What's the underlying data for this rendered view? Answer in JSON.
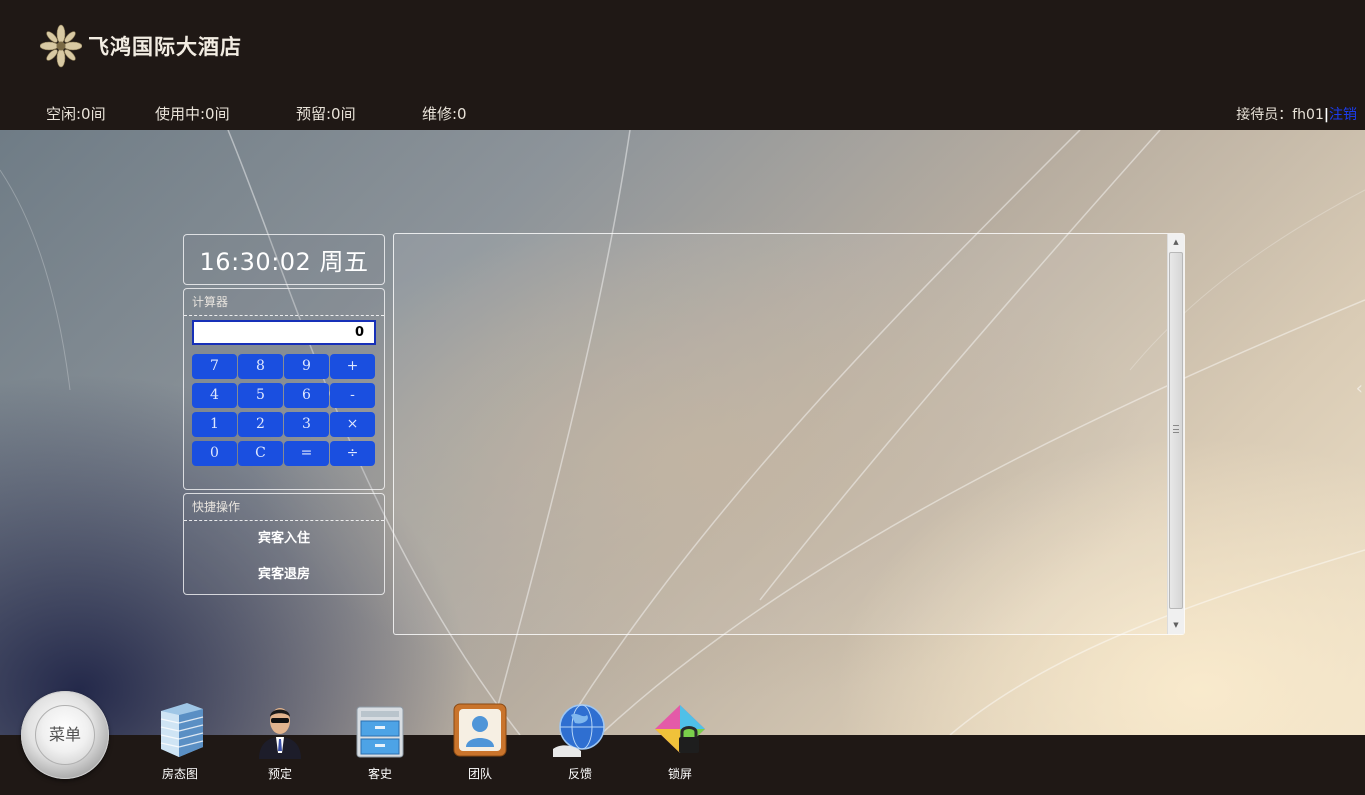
{
  "header": {
    "hotel_name": "飞鸿国际大酒店",
    "stats": {
      "vacant": "空闲:0间",
      "in_use": "使用中:0间",
      "reserved": "预留:0间",
      "maintenance": "维修:0"
    },
    "receptionist_label": "接待员：fh01",
    "separator": "|",
    "logout": "注销"
  },
  "clock": {
    "display": "16:30:02 周五"
  },
  "calculator": {
    "title": "计算器",
    "display_value": "0",
    "keys": [
      "7",
      "8",
      "9",
      "+",
      "4",
      "5",
      "6",
      "-",
      "1",
      "2",
      "3",
      "×",
      "0",
      "C",
      "=",
      "÷"
    ]
  },
  "quick_actions": {
    "title": "快捷操作",
    "items": [
      "宾客入住",
      "宾客退房"
    ]
  },
  "taskbar": {
    "menu_label": "菜单",
    "items": [
      {
        "label": "房态图",
        "icon": "building-icon"
      },
      {
        "label": "预定",
        "icon": "person-icon"
      },
      {
        "label": "客史",
        "icon": "cabinet-icon"
      },
      {
        "label": "团队",
        "icon": "contact-card-icon"
      },
      {
        "label": "反馈",
        "icon": "globe-icon"
      },
      {
        "label": "锁屏",
        "icon": "lock-icon"
      }
    ]
  },
  "colors": {
    "header_bg": "#1f1815",
    "calc_key": "#1a4fe0",
    "logout_link": "#1b3df0"
  }
}
